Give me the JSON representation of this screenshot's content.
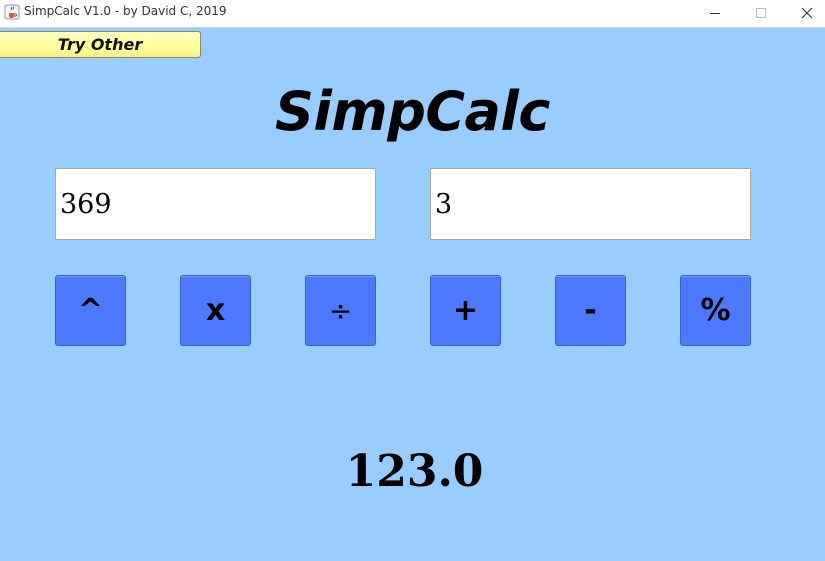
{
  "window": {
    "title": "SimpCalc V1.0 - by David C, 2019",
    "app_icon": "java-cup-icon",
    "controls": {
      "minimize_icon": "minimize-icon",
      "maximize_icon": "maximize-icon",
      "close_icon": "close-icon"
    }
  },
  "toolbar": {
    "try_other_label": "Try Other"
  },
  "heading": {
    "title": "SimpCalc"
  },
  "inputs": {
    "first_value": "369",
    "second_value": "3"
  },
  "operators": {
    "power": "^",
    "multiply": "x",
    "divide": "÷",
    "add": "+",
    "subtract": "-",
    "modulo": "%"
  },
  "result": {
    "value": "123.0"
  },
  "colors": {
    "background": "#99ccff",
    "operator_button": "#4d79ff",
    "try_other_button": "#ffff99",
    "input_background": "#ffffff",
    "titlebar": "#ffffff"
  }
}
